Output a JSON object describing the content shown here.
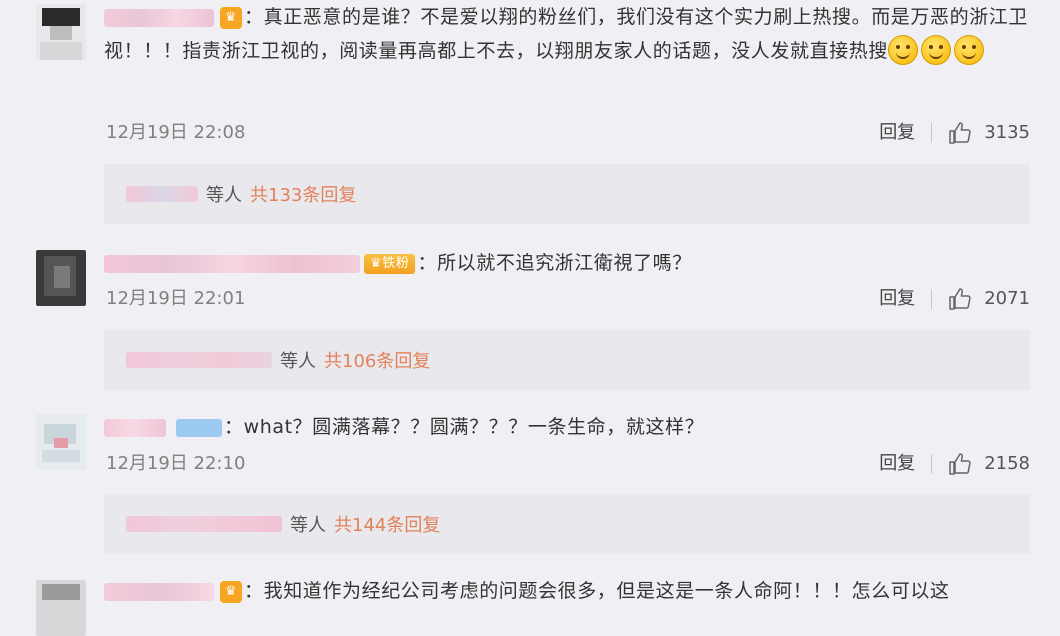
{
  "comments": [
    {
      "text": "：真正恶意的是谁？不是爱以翔的粉丝们，我们没有这个实力刷上热搜。而是万恶的浙江卫视！！！指责浙江卫视的，阅读量再高都上不去，以翔朋友家人的话题，没人发就直接热搜",
      "emoji": [
        "smile-emoji",
        "smile-emoji",
        "smile-emoji"
      ],
      "time": "12月19日 22:08",
      "reply_label": "回复",
      "likes": "3135",
      "replies_label": "等人",
      "replies_total": "共133条回复"
    },
    {
      "text": "：所以就不追究浙江衛視了嗎？",
      "badge": "铁粉",
      "time": "12月19日 22:01",
      "reply_label": "回复",
      "likes": "2071",
      "replies_label": "等人",
      "replies_total": "共106条回复"
    },
    {
      "text": "：what？圆满落幕？？圆满？？？一条生命，就这样？",
      "time": "12月19日 22:10",
      "reply_label": "回复",
      "likes": "2158",
      "replies_label": "等人",
      "replies_total": "共144条回复"
    },
    {
      "text": "：我知道作为经纪公司考虑的问题会很多，但是这是一条人命阿！！！怎么可以这"
    }
  ],
  "colors": {
    "background": "#f0f0f4",
    "reply_total": "#e3815b",
    "time": "#808080"
  }
}
